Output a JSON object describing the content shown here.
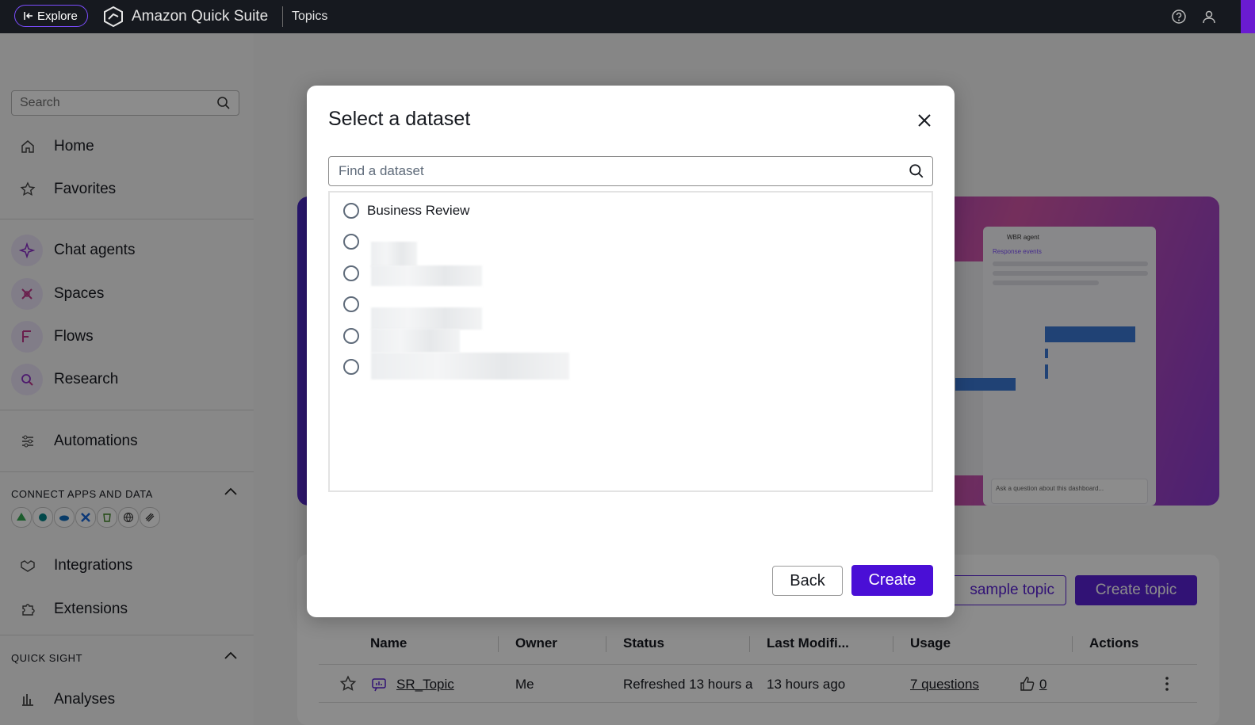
{
  "topbar": {
    "explore_label": "Explore",
    "brand": "Amazon Quick Suite",
    "crumb": "Topics"
  },
  "sidebar": {
    "search_placeholder": "Search",
    "items": [
      {
        "label": "Home"
      },
      {
        "label": "Favorites"
      },
      {
        "label": "Chat agents"
      },
      {
        "label": "Spaces"
      },
      {
        "label": "Flows"
      },
      {
        "label": "Research"
      },
      {
        "label": "Automations"
      },
      {
        "label": "Integrations"
      },
      {
        "label": "Extensions"
      },
      {
        "label": "Analyses"
      }
    ],
    "section_connect": "CONNECT APPS AND DATA",
    "section_quicksight": "QUICK SIGHT"
  },
  "hero": {
    "agent_label": "WBR agent",
    "response_label": "Response events",
    "ask_placeholder": "Ask a question about this dashboard..."
  },
  "topics": {
    "sample_button": "sample topic",
    "create_button": "Create topic",
    "columns": [
      "Name",
      "Owner",
      "Status",
      "Last Modifi...",
      "Usage",
      "Actions"
    ],
    "rows": [
      {
        "name": "SR_Topic",
        "owner": "Me",
        "status": "Refreshed 13 hours a",
        "last_modified": "13 hours ago",
        "usage": "7 questions",
        "likes": "0"
      }
    ]
  },
  "modal": {
    "title": "Select a dataset",
    "search_placeholder": "Find a dataset",
    "datasets": [
      {
        "label": "Business Review"
      }
    ],
    "back_label": "Back",
    "create_label": "Create"
  },
  "colors": {
    "accent": "#4a0fd6",
    "topbar": "#16191f"
  }
}
